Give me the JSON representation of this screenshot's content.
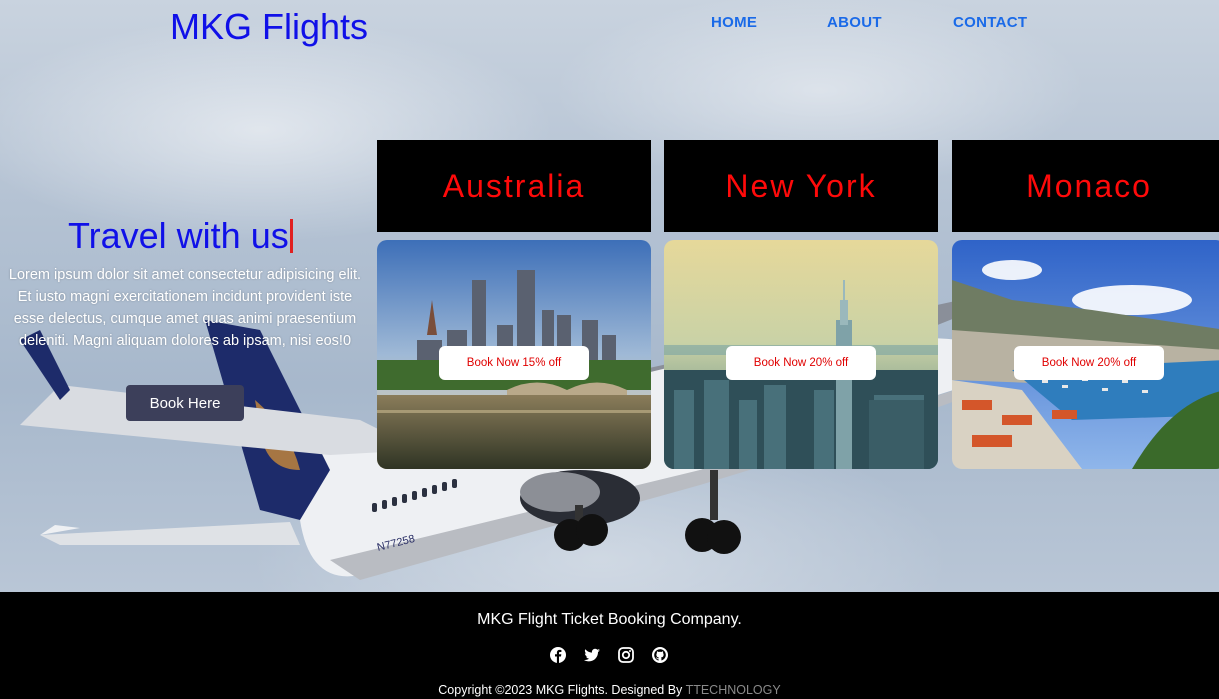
{
  "header": {
    "logo": "MKG Flights",
    "nav": [
      {
        "label": "HOME"
      },
      {
        "label": "ABOUT"
      },
      {
        "label": "CONTACT"
      }
    ]
  },
  "hero": {
    "title": "Travel with us",
    "description": "Lorem ipsum dolor sit amet consectetur adipisicing elit. Et iusto magni exercitationem incidunt provident iste esse delectus, cumque amet quas animi praesentium deleniti. Magni aliquam dolores ab ipsam, nisi eos!0",
    "cta": "Book Here",
    "plane_registration": "N77258"
  },
  "destinations": [
    {
      "name": "Australia",
      "offer": "Book Now 15% off"
    },
    {
      "name": "New York",
      "offer": "Book Now 20% off"
    },
    {
      "name": "Monaco",
      "offer": "Book Now 20% off"
    }
  ],
  "footer": {
    "title": "MKG Flight Ticket Booking Company.",
    "socials": [
      "facebook-icon",
      "twitter-icon",
      "instagram-icon",
      "github-icon"
    ],
    "copyright": "Copyright ©2023 MKG Flights. Designed By",
    "designer": "TTECHNOLOGY"
  },
  "colors": {
    "logo": "#1010e8",
    "nav": "#1a6ae8",
    "card_title": "#ff0a0a",
    "offer_text": "#e00000"
  }
}
